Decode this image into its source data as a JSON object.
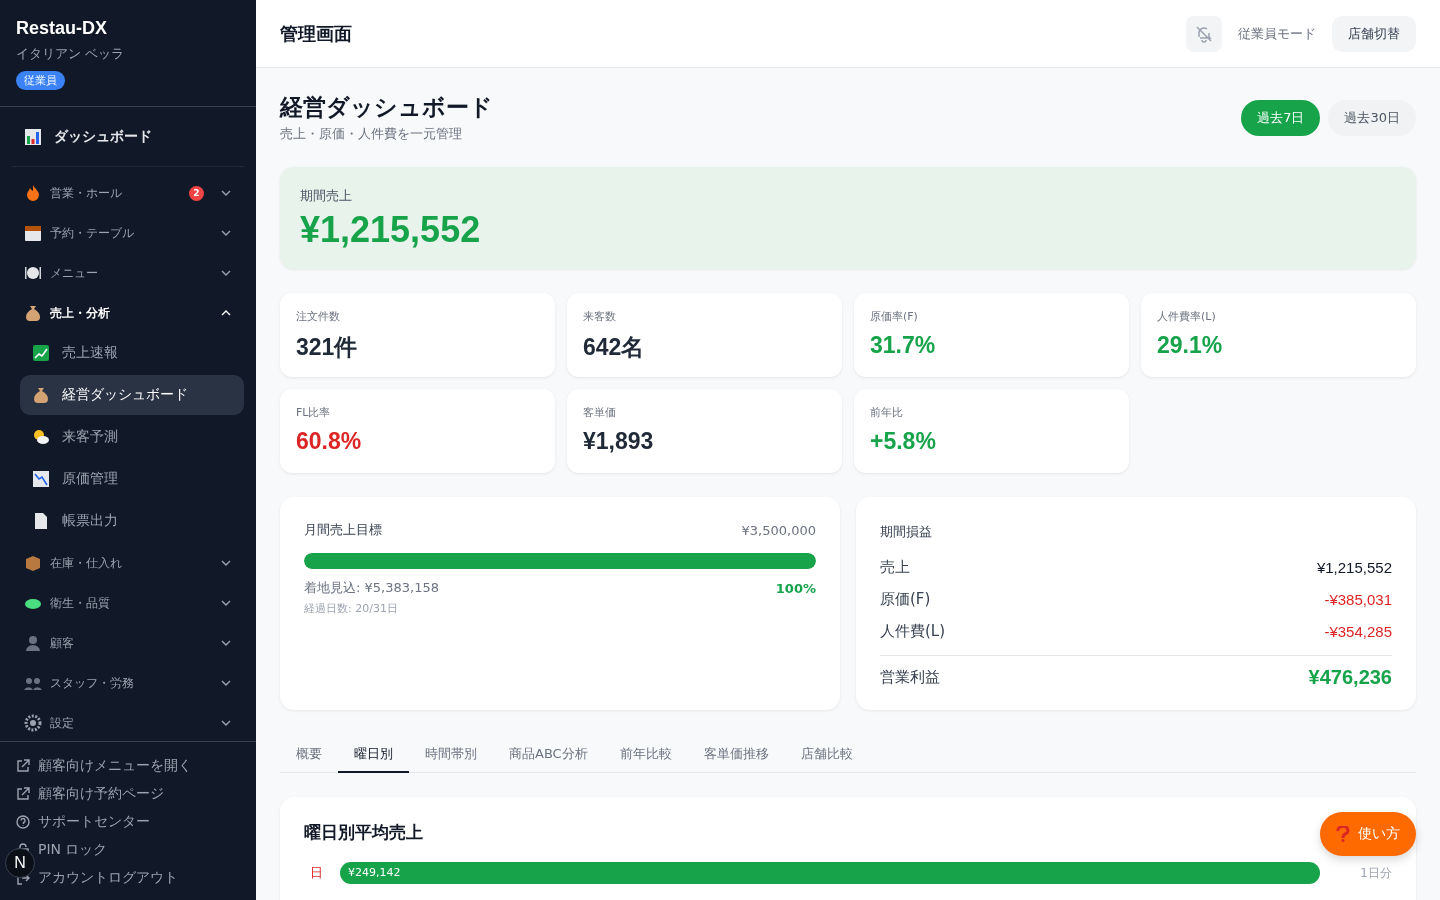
{
  "sidebar": {
    "brand": "Restau-DX",
    "store": "イタリアン ベッラ",
    "role_badge": "従業員",
    "dashboard": {
      "label": "ダッシュボード"
    },
    "groups": [
      {
        "label": "営業・ホール",
        "badge": "2",
        "expanded": false
      },
      {
        "label": "予約・テーブル",
        "expanded": false
      },
      {
        "label": "メニュー",
        "expanded": false
      },
      {
        "label": "売上・分析",
        "expanded": true,
        "children": [
          {
            "label": "売上速報",
            "selected": false
          },
          {
            "label": "経営ダッシュボード",
            "selected": true
          },
          {
            "label": "来客予測",
            "selected": false
          },
          {
            "label": "原価管理",
            "selected": false
          },
          {
            "label": "帳票出力",
            "selected": false
          }
        ]
      },
      {
        "label": "在庫・仕入れ",
        "expanded": false
      },
      {
        "label": "衛生・品質",
        "expanded": false
      },
      {
        "label": "顧客",
        "expanded": false
      },
      {
        "label": "スタッフ・労務",
        "expanded": false
      },
      {
        "label": "設定",
        "expanded": false
      }
    ],
    "footer_links": [
      {
        "label": "顧客向けメニューを開く",
        "kind": "external"
      },
      {
        "label": "顧客向け予約ページ",
        "kind": "external"
      },
      {
        "label": "サポートセンター",
        "kind": "help"
      },
      {
        "label": "PIN ロック",
        "kind": "lock"
      },
      {
        "label": "アカウントログアウト",
        "kind": "logout"
      }
    ],
    "avatar": "N"
  },
  "header": {
    "title": "管理画面",
    "employee_mode": "従業員モード",
    "store_switch": "店舗切替"
  },
  "page": {
    "title": "経営ダッシュボード",
    "subtitle": "売上・原価・人件費を一元管理",
    "ranges": [
      {
        "label": "過去7日",
        "selected": true
      },
      {
        "label": "過去30日",
        "selected": false
      }
    ]
  },
  "hero": {
    "label": "期間売上",
    "value": "¥1,215,552"
  },
  "kpis": [
    {
      "label": "注文件数",
      "value": "321件",
      "color": "#1f2937"
    },
    {
      "label": "来客数",
      "value": "642名",
      "color": "#1f2937"
    },
    {
      "label": "原価率(F)",
      "value": "31.7%",
      "color": "#16a34a"
    },
    {
      "label": "人件費率(L)",
      "value": "29.1%",
      "color": "#16a34a"
    },
    {
      "label": "FL比率",
      "value": "60.8%",
      "color": "#dc2626"
    },
    {
      "label": "客単価",
      "value": "¥1,893",
      "color": "#1f2937"
    },
    {
      "label": "前年比",
      "value": "+5.8%",
      "color": "#16a34a"
    }
  ],
  "goal": {
    "title": "月間売上目標",
    "target": "¥3,500,000",
    "level": 1,
    "forecast": "着地見込: ¥5,383,158",
    "percent": "100%",
    "elapsed": "経過日数: 20/31日"
  },
  "pl": {
    "title": "期間損益",
    "rows": [
      {
        "label": "売上",
        "value": "¥1,215,552",
        "kind": "income"
      },
      {
        "label": "原価(F)",
        "value": "-¥385,031",
        "kind": "cost"
      },
      {
        "label": "人件費(L)",
        "value": "-¥354,285",
        "kind": "cost"
      }
    ],
    "total": {
      "label": "営業利益",
      "value": "¥476,236"
    }
  },
  "tabs": [
    {
      "label": "概要",
      "selected": false
    },
    {
      "label": "曜日別",
      "selected": true
    },
    {
      "label": "時間帯別",
      "selected": false
    },
    {
      "label": "商品ABC分析",
      "selected": false
    },
    {
      "label": "前年比較",
      "selected": false
    },
    {
      "label": "客単価推移",
      "selected": false
    },
    {
      "label": "店舗比較",
      "selected": false
    }
  ],
  "weekday": {
    "title": "曜日別平均売上",
    "rows": [
      {
        "day": "日",
        "value": "¥249,142",
        "level": 1,
        "note": "1日分"
      }
    ]
  },
  "help_button": {
    "label": "使い方"
  }
}
